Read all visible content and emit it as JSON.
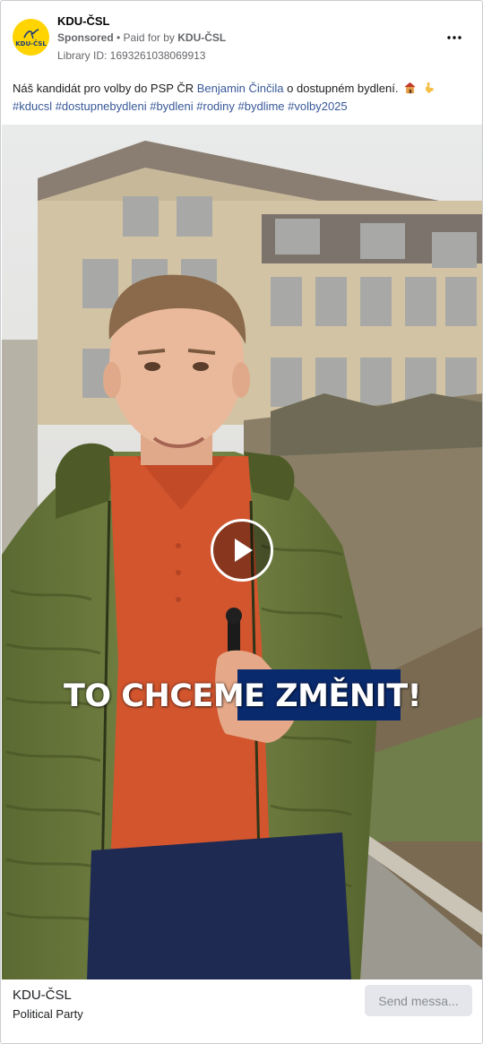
{
  "header": {
    "page_name": "KDU-ČSL",
    "avatar_text": "KDU-ČSL",
    "sponsored": "Sponsored",
    "separator": " • ",
    "paid_for_by": "Paid for by ",
    "payer": "KDU-ČSL",
    "library_id": "Library ID: 1693261038069913"
  },
  "caption": {
    "text_before": "Náš kandidát pro volby do PSP ČR ",
    "link_text": "Benjamin Činčila",
    "text_after": " o dostupném bydlení.",
    "hashtags": "#kducsl #dostupnebydleni #bydleni #rodiny #bydlime #volby2025",
    "emojis": [
      "house-emoji",
      "pointing-down-emoji"
    ]
  },
  "video": {
    "subtitle": "TO CHCEME ZMĚNIT!",
    "play_icon": "play-icon",
    "subtitle_highlight_color": "#0a2a6e"
  },
  "footer": {
    "title": "KDU-ČSL",
    "subtitle": "Political Party",
    "send_button": "Send messa..."
  },
  "colors": {
    "link": "#385898",
    "meta": "#65676b",
    "brand_yellow": "#ffd400",
    "brand_blue": "#1a3a7a"
  }
}
